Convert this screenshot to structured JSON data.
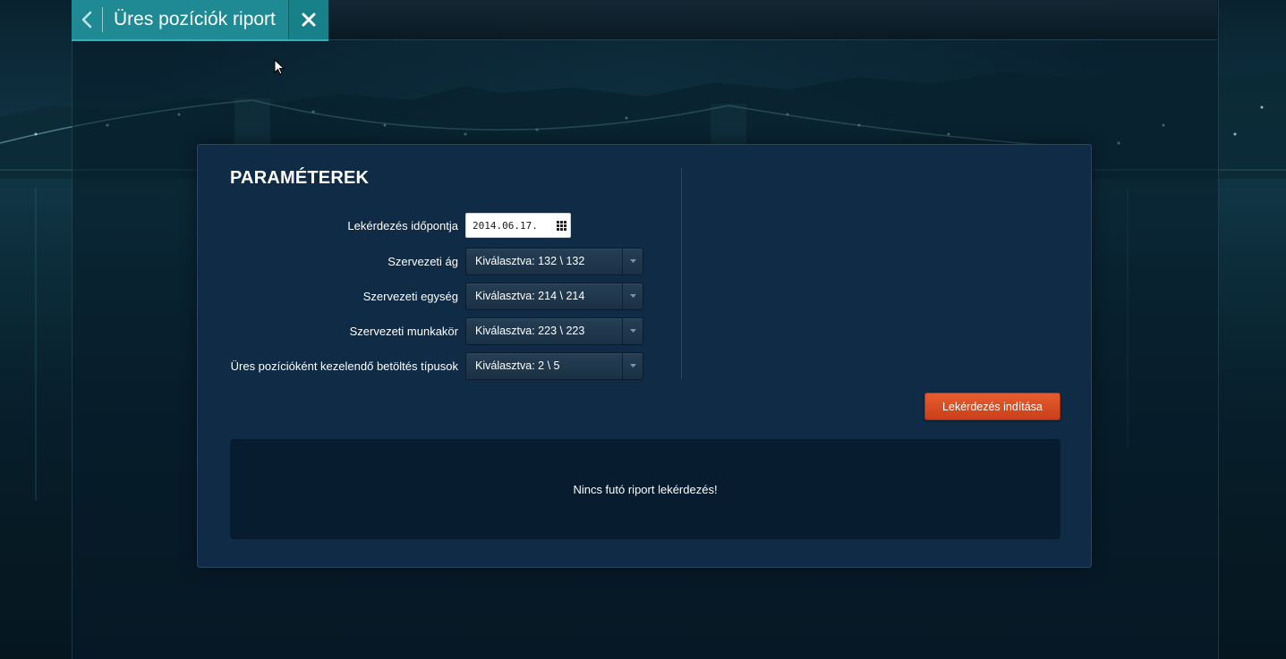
{
  "header": {
    "back_icon": "chevron-left-icon",
    "title": "Üres pozíciók riport",
    "close_icon": "close-icon"
  },
  "panel": {
    "heading": "PARAMÉTEREK",
    "fields": {
      "date": {
        "label": "Lekérdezés időpontja",
        "value": "2014.06.17.",
        "icon": "calendar-grid-icon"
      },
      "branch": {
        "label": "Szervezeti ág",
        "value": "Kiválasztva: 132 \\ 132"
      },
      "unit": {
        "label": "Szervezeti egység",
        "value": "Kiválasztva: 214 \\ 214"
      },
      "job": {
        "label": "Szervezeti munkakör",
        "value": "Kiválasztva: 223 \\ 223"
      },
      "load_types": {
        "label": "Üres pozícióként kezelendő betöltés típusok",
        "value": "Kiválasztva: 2 \\ 5"
      }
    },
    "run_button": "Lekérdezés indítása",
    "status_message": "Nincs futó riport lekérdezés!"
  },
  "colors": {
    "tab_accent": "#1f8a93",
    "run_button": "#d94c22",
    "panel_bg": "#0f2b45"
  }
}
